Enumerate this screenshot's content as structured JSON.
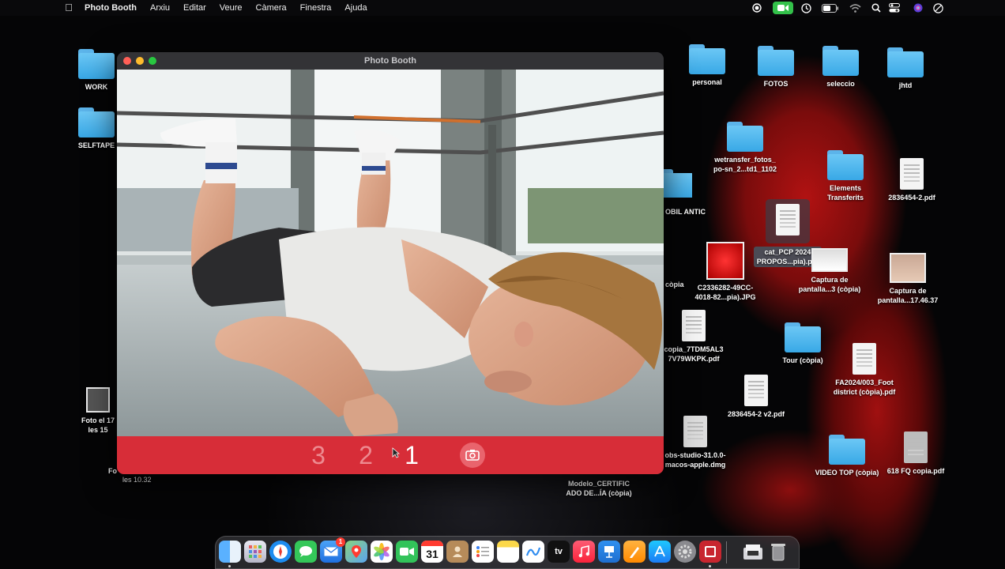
{
  "menubar": {
    "app_name": "Photo Booth",
    "menus": [
      "Arxiu",
      "Editar",
      "Veure",
      "Càmera",
      "Finestra",
      "Ajuda"
    ],
    "status_icons": [
      "record-icon",
      "facetime-camera-icon",
      "screen-time-icon",
      "battery-icon",
      "wifi-icon",
      "search-icon",
      "control-center-icon",
      "siri-icon",
      "do-not-disturb-icon"
    ]
  },
  "window": {
    "title": "Photo Booth",
    "countdown": [
      "3",
      "2",
      "1"
    ],
    "capture_icon": "camera-icon"
  },
  "desktop_left": [
    {
      "label": "WORK",
      "kind": "folder"
    },
    {
      "label": "SELFTAPE",
      "kind": "folder"
    },
    {
      "label": "Foto el 17\nles 15",
      "kind": "thumb"
    },
    {
      "label": "Fo",
      "kind": "text"
    },
    {
      "label": "les 10.32",
      "kind": "text"
    }
  ],
  "desktop_right": [
    {
      "label": "personal",
      "kind": "folder"
    },
    {
      "label": "FOTOS",
      "kind": "folder"
    },
    {
      "label": "seleccio",
      "kind": "folder"
    },
    {
      "label": "jhtd",
      "kind": "folder"
    },
    {
      "label": "wetransfer_fotos_\npo-sn_2...td1_1102",
      "kind": "folder"
    },
    {
      "label": "Elements\nTransferits",
      "kind": "folder"
    },
    {
      "label": "2836454-2.pdf",
      "kind": "doc"
    },
    {
      "label": "OBIL ANTIC",
      "kind": "folder"
    },
    {
      "label": "cat_PCP 2024\nPROPOS...pia).pdf",
      "kind": "doc"
    },
    {
      "label": "C2336282-49CC-\n4018-82...pia).JPG",
      "kind": "thumb"
    },
    {
      "label": "Captura de\npantalla...3 (còpia)",
      "kind": "thumb"
    },
    {
      "label": "Captura de\npantalla...17.46.37",
      "kind": "thumb"
    },
    {
      "label": "còpia",
      "kind": "text"
    },
    {
      "label": "copia_7TDM5AL3\n7V79WKPK.pdf",
      "kind": "doc"
    },
    {
      "label": "Tour (còpia)",
      "kind": "folder"
    },
    {
      "label": "FA2024/003_Foot\ndistrict (còpia).pdf",
      "kind": "doc"
    },
    {
      "label": "2836454-2 v2.pdf",
      "kind": "doc"
    },
    {
      "label": "obs-studio-31.0.0-\nmacos-apple.dmg",
      "kind": "doc"
    },
    {
      "label": "VIDEO TOP (còpia)",
      "kind": "folder"
    },
    {
      "label": "618 FQ copia.pdf",
      "kind": "doc"
    },
    {
      "label": "Modelo_CERTIFIC\nADO DE...ÍA (còpia)",
      "kind": "text"
    }
  ],
  "dock": {
    "apps": [
      "finder-icon",
      "launchpad-icon",
      "safari-icon",
      "messages-icon",
      "mail-icon",
      "maps-icon",
      "photos-icon",
      "facetime-icon",
      "calendar-icon",
      "contacts-icon",
      "reminders-icon",
      "notes-icon",
      "freeform-icon",
      "tv-icon",
      "music-icon",
      "keynote-icon",
      "pages-icon",
      "app-store-icon",
      "system-settings-icon",
      "photo-booth-icon"
    ],
    "calendar_day": "31",
    "mail_badge": "1",
    "tv_label": "tv",
    "extras": [
      "downloads-stack-icon",
      "trash-icon"
    ]
  },
  "colors": {
    "countdown_bar": "#d72d38",
    "folder_blue": "#4fb6ef",
    "wallpaper_red": "#b11212"
  }
}
